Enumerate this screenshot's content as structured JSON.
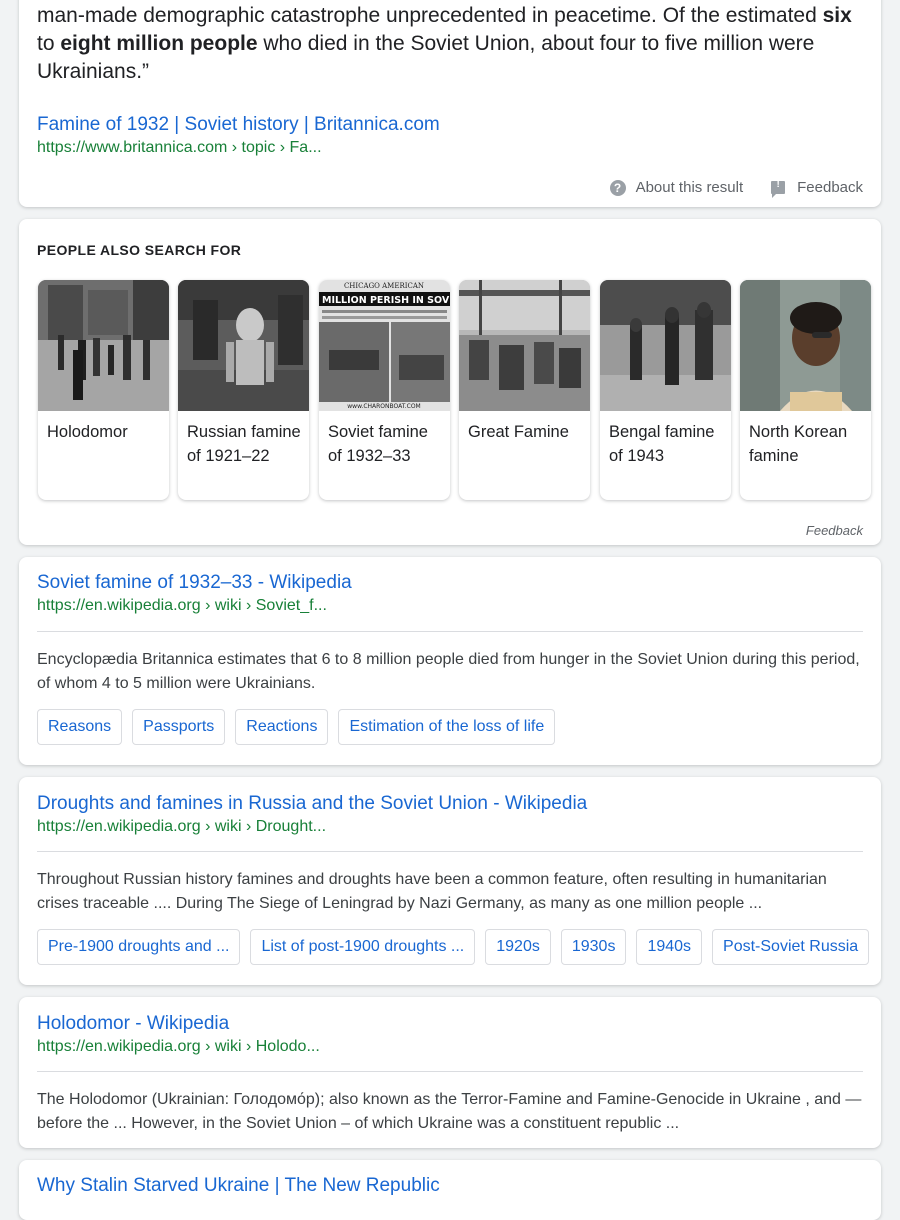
{
  "top_result": {
    "snippet_parts": {
      "p1": "man-made demographic catastrophe unprecedented in peacetime. Of the estimated ",
      "b1": "six",
      "p2": " to ",
      "b2": "eight million people",
      "p3": " who died in the Soviet Union, about four to five million were Ukrainians.”"
    },
    "title": "Famine of 1932 | Soviet history | Britannica.com",
    "url": "https://www.britannica.com › topic › Fa...",
    "about_label": "About this result",
    "feedback_label": "Feedback"
  },
  "people_also_search": {
    "heading": "PEOPLE ALSO SEARCH FOR",
    "items": [
      {
        "label": "Holodomor"
      },
      {
        "label": "Russian famine of 1921–22"
      },
      {
        "label": "Soviet famine of 1932–33",
        "image_text": "MILLION PERISH IN SOVIET F",
        "image_masthead": "CHICAGO AMERICAN",
        "image_footer": "www.CHARONBOAT.COM"
      },
      {
        "label": "Great Famine"
      },
      {
        "label": "Bengal famine of 1943"
      },
      {
        "label": "North Korean famine"
      }
    ],
    "feedback_label": "Feedback"
  },
  "results": [
    {
      "title": "Soviet famine of 1932–33 - Wikipedia",
      "url": "https://en.wikipedia.org › wiki › Soviet_f...",
      "snippet": "Encyclopædia Britannica estimates that 6 to 8 million people died from hunger in the Soviet Union during this period, of whom 4 to 5 million were Ukrainians.",
      "chips": [
        "Reasons",
        "Passports",
        "Reactions",
        "Estimation of the loss of life"
      ]
    },
    {
      "title": "Droughts and famines in Russia and the Soviet Union - Wikipedia",
      "url": "https://en.wikipedia.org › wiki › Drought...",
      "snippet": "Throughout Russian history famines and droughts have been a common feature, often resulting in humanitarian crises traceable .... During The Siege of Leningrad by Nazi Germany, as many as one million people ...",
      "chips": [
        "Pre-1900 droughts and ...",
        "List of post-1900 droughts ...",
        "1920s",
        "1930s",
        "1940s",
        "Post-Soviet Russia"
      ]
    },
    {
      "title": "Holodomor - Wikipedia",
      "url": "https://en.wikipedia.org › wiki › Holodo...",
      "snippet": "The Holodomor (Ukrainian: Голодомо́р); also known as the Terror-Famine and Famine-Genocide in Ukraine , and —before the ... However, in the Soviet Union – of which Ukraine was a constituent republic ..."
    },
    {
      "title": "Why Stalin Starved Ukraine | The New Republic"
    }
  ],
  "colors": {
    "link": "#1967d2",
    "url": "#188038",
    "background": "#f1f3f4"
  }
}
